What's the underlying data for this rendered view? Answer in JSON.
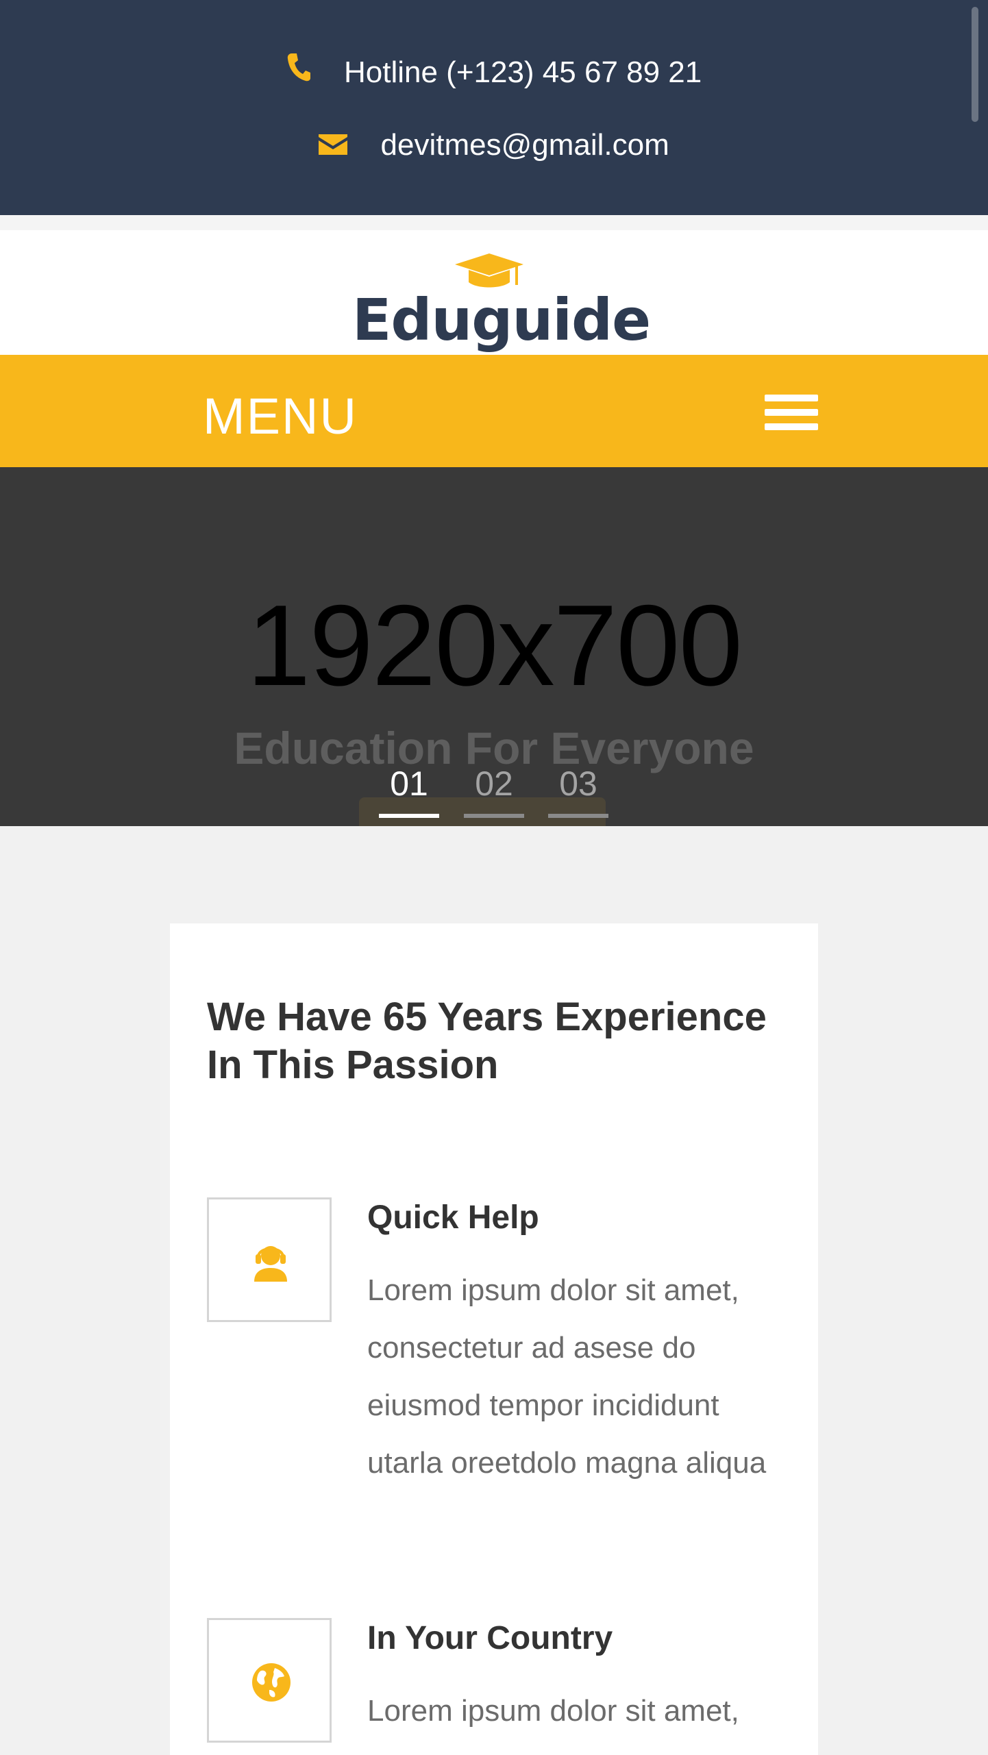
{
  "topbar": {
    "hotline": "Hotline (+123) 45 67 89 21",
    "email": "devitmes@gmail.com",
    "icons": {
      "phone": "phone-icon",
      "mail": "envelope-icon"
    }
  },
  "brand": {
    "name": "Eduguide",
    "logo_icon": "graduation-cap-icon"
  },
  "nav": {
    "menu_label": "MENU",
    "toggle_icon": "hamburger-icon"
  },
  "hero": {
    "placeholder": "1920x700",
    "title": "Education For Everyone",
    "slides": [
      "01",
      "02",
      "03"
    ],
    "active_slide": 0
  },
  "about": {
    "title": "We Have 65 Years Experience In This Passion",
    "features": [
      {
        "icon": "support-agent-icon",
        "title": "Quick Help",
        "text": "Lorem ipsum dolor sit amet, consectetur ad asese do eiusmod tempor incididunt utarla oreetdolo magna aliqua"
      },
      {
        "icon": "globe-icon",
        "title": "In Your Country",
        "text": "Lorem ipsum dolor sit amet,"
      }
    ]
  },
  "colors": {
    "navy": "#2e3b51",
    "accent": "#f8b71b",
    "hero_bg": "#393939",
    "page_bg": "#f1f1f1"
  }
}
